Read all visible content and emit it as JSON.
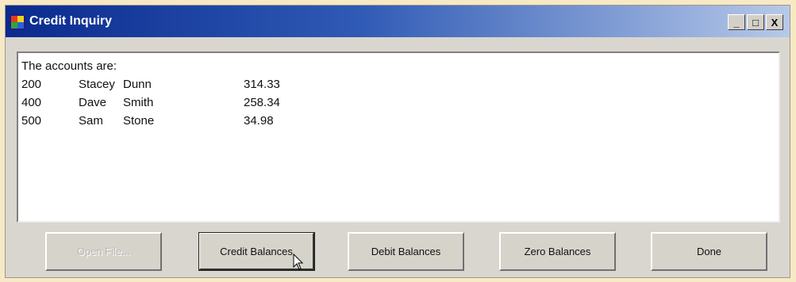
{
  "window": {
    "title": "Credit Inquiry",
    "minimize_label": "_",
    "maximize_label": "□",
    "close_label": "X"
  },
  "output": {
    "heading": "The accounts are:",
    "rows": [
      {
        "account": "200",
        "first": "Stacey",
        "last": "Dunn",
        "balance": "314.33"
      },
      {
        "account": "400",
        "first": "Dave",
        "last": "Smith",
        "balance": "258.34"
      },
      {
        "account": "500",
        "first": "Sam",
        "last": "Stone",
        "balance": "34.98"
      }
    ]
  },
  "buttons": {
    "open_file": "Open File...",
    "credit_balances": "Credit Balances",
    "debit_balances": "Debit Balances",
    "zero_balances": "Zero Balances",
    "done": "Done"
  },
  "icons": {
    "app": "app-window-icon",
    "cursor": "mouse-pointer-icon"
  },
  "colors": {
    "titlebar_start": "#0a2a8e",
    "titlebar_end": "#b7c9e9",
    "window_face": "#d9d6cf",
    "page_background": "#f7e9c4"
  }
}
